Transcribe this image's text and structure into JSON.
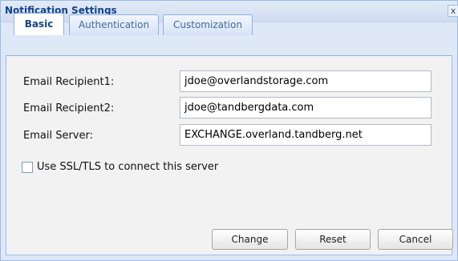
{
  "dialog": {
    "title": "Notification Settings",
    "close_label": "x"
  },
  "tabs": [
    {
      "label": "Basic",
      "active": true
    },
    {
      "label": "Authentication",
      "active": false
    },
    {
      "label": "Customization",
      "active": false
    }
  ],
  "form": {
    "recipient1": {
      "label": "Email Recipient1:",
      "value": "jdoe@overlandstorage.com"
    },
    "recipient2": {
      "label": "Email Recipient2:",
      "value": "jdoe@tandbergdata.com"
    },
    "server": {
      "label": "Email Server:",
      "value": "EXCHANGE.overland.tandberg.net"
    },
    "ssl": {
      "label": "Use SSL/TLS to connect this server",
      "checked": false
    }
  },
  "buttons": {
    "change": "Change",
    "reset": "Reset",
    "cancel": "Cancel"
  }
}
